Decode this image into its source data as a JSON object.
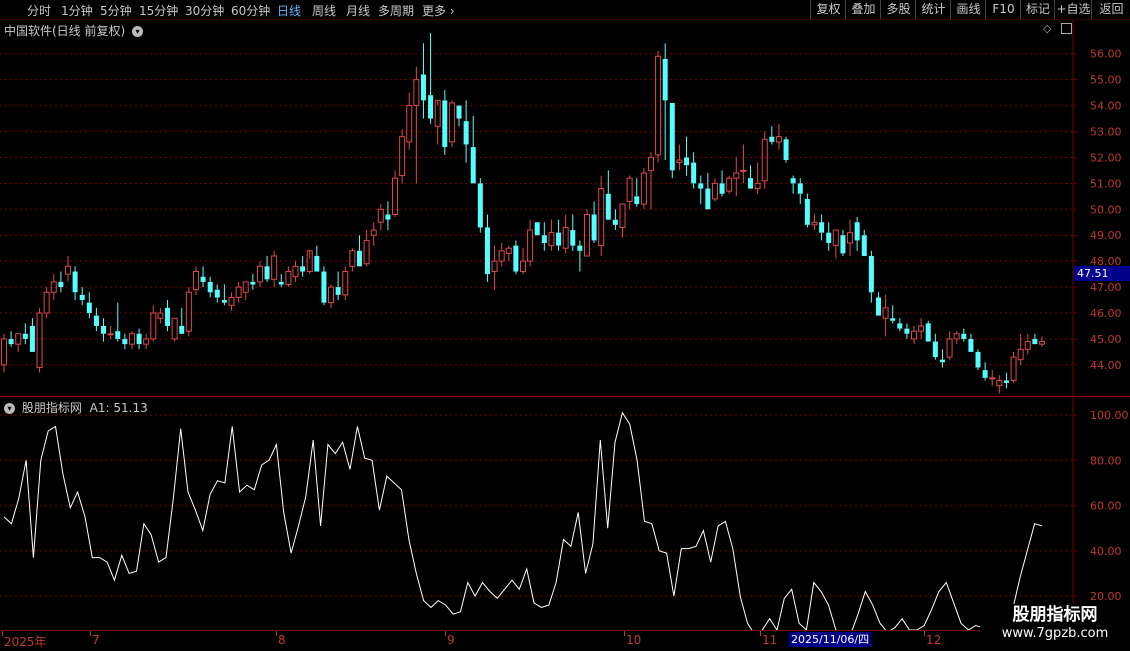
{
  "toolbar": {
    "left": [
      "分时",
      "1分钟",
      "5分钟",
      "15分钟",
      "30分钟",
      "60分钟",
      "日线",
      "周线",
      "月线",
      "多周期",
      "更多"
    ],
    "active": "日线",
    "right": [
      "复权",
      "叠加",
      "多股",
      "统计",
      "画线",
      "F10",
      "标记",
      "+自选",
      "返回"
    ]
  },
  "main_panel": {
    "title": "中国软件(日线 前复权)",
    "current_price": "47.51"
  },
  "indicator_panel": {
    "name": "股朋指标网",
    "value_label": "A1: 51.13"
  },
  "x_axis": {
    "labels": [
      "2025年",
      "7",
      "8",
      "9",
      "10",
      "11",
      "12"
    ],
    "crosshair_date": "2025/11/06/四"
  },
  "watermark": {
    "title": "股朋指标网",
    "url": "www.7gpzb.com"
  },
  "colors": {
    "up": "#e04848",
    "down": "#54ffff",
    "grid": "#7a0000",
    "line": "#ffffff"
  },
  "chart_data": [
    {
      "type": "candlestick",
      "title": "中国软件(日线 前复权)",
      "y_ticks": [
        44,
        45,
        46,
        47,
        48,
        49,
        50,
        51,
        52,
        53,
        54,
        55,
        56
      ],
      "ylim": [
        42.8,
        57.3
      ],
      "candles": [
        [
          44,
          45.2,
          43.7,
          45
        ],
        [
          45,
          45.3,
          44.7,
          44.8
        ],
        [
          44.8,
          45.2,
          44.5,
          45.2
        ],
        [
          45.2,
          45.6,
          44.8,
          45
        ],
        [
          45.5,
          45.8,
          44.5,
          44.5
        ],
        [
          43.9,
          46.2,
          43.7,
          46
        ],
        [
          46,
          47,
          45.8,
          46.8
        ],
        [
          46.8,
          47.5,
          46.5,
          47.2
        ],
        [
          47.2,
          47.6,
          46.8,
          47
        ],
        [
          47.5,
          48.2,
          47.2,
          47.8
        ],
        [
          47.6,
          47.8,
          46.5,
          46.8
        ],
        [
          46.7,
          47,
          46.3,
          46.5
        ],
        [
          46.4,
          46.8,
          45.8,
          46
        ],
        [
          45.9,
          46.2,
          45.3,
          45.5
        ],
        [
          45.5,
          45.8,
          44.9,
          45.2
        ],
        [
          45.2,
          45.5,
          45,
          45.2
        ],
        [
          45.3,
          46.4,
          44.9,
          45
        ],
        [
          45,
          45.2,
          44.6,
          44.8
        ],
        [
          44.8,
          45.3,
          44.6,
          45.2
        ],
        [
          45.2,
          45.4,
          44.6,
          44.8
        ],
        [
          44.8,
          45.2,
          44.6,
          45
        ],
        [
          45,
          46.3,
          44.9,
          46
        ],
        [
          45.8,
          46.2,
          45.6,
          46
        ],
        [
          46.2,
          46.5,
          45.3,
          45.5
        ],
        [
          45,
          45.8,
          44.9,
          45.8
        ],
        [
          45.5,
          46.2,
          45.3,
          45.2
        ],
        [
          45.3,
          47,
          45.1,
          46.8
        ],
        [
          46.9,
          47.8,
          46.7,
          47.6
        ],
        [
          47.4,
          47.8,
          47,
          47.2
        ],
        [
          47.2,
          47.4,
          46.6,
          46.8
        ],
        [
          46.9,
          47.1,
          46.4,
          46.6
        ],
        [
          46.5,
          47.1,
          46.3,
          46.4
        ],
        [
          46.3,
          46.8,
          46.1,
          46.6
        ],
        [
          46.6,
          47.2,
          46.4,
          47
        ],
        [
          46.8,
          47.2,
          46.5,
          47.2
        ],
        [
          47.2,
          47.5,
          46.9,
          47.1
        ],
        [
          47.2,
          48,
          47,
          47.8
        ],
        [
          47.8,
          48.2,
          47.2,
          47.3
        ],
        [
          47.3,
          48.4,
          47,
          48.2
        ],
        [
          47.2,
          47.5,
          47,
          47.1
        ],
        [
          47.1,
          47.8,
          47,
          47.6
        ],
        [
          47.4,
          48,
          47.2,
          47.8
        ],
        [
          47.8,
          48.2,
          47.4,
          47.6
        ],
        [
          47.6,
          48.1,
          47.5,
          48.4
        ],
        [
          48.2,
          48.6,
          47.6,
          47.6
        ],
        [
          47.6,
          47.8,
          46.3,
          46.4
        ],
        [
          46.4,
          47.1,
          46.2,
          47
        ],
        [
          47,
          47.6,
          46.5,
          46.7
        ],
        [
          46.7,
          47.8,
          46.5,
          47.6
        ],
        [
          47.8,
          48.5,
          47.6,
          48.4
        ],
        [
          48.4,
          49,
          47.8,
          47.8
        ],
        [
          47.9,
          49.2,
          47.8,
          48.8
        ],
        [
          49,
          49.5,
          48.6,
          49.2
        ],
        [
          49.5,
          50.2,
          49.2,
          50
        ],
        [
          49.8,
          50.3,
          49.2,
          49.6
        ],
        [
          49.8,
          51.5,
          49.7,
          51.2
        ],
        [
          51.3,
          53.1,
          51,
          52.8
        ],
        [
          52.6,
          54.5,
          52.3,
          54
        ],
        [
          54,
          55.5,
          51,
          55
        ],
        [
          55.2,
          56.4,
          53.5,
          54.2
        ],
        [
          54.4,
          56.8,
          53.3,
          53.5
        ],
        [
          53.2,
          54,
          52.5,
          54.2
        ],
        [
          54.2,
          54.6,
          52.1,
          52.4
        ],
        [
          52.6,
          54.2,
          52.4,
          54.1
        ],
        [
          54,
          54,
          53.2,
          53.5
        ],
        [
          53.4,
          54.2,
          51.8,
          52.5
        ],
        [
          52.4,
          53.6,
          51,
          51
        ],
        [
          51,
          51.2,
          49.1,
          49.3
        ],
        [
          49.3,
          49.8,
          47.2,
          47.5
        ],
        [
          47.6,
          48.6,
          46.9,
          48
        ],
        [
          48,
          48.7,
          47.8,
          48.4
        ],
        [
          48.3,
          48.6,
          48,
          48.5
        ],
        [
          48.6,
          48.8,
          47.5,
          47.6
        ],
        [
          47.6,
          48.5,
          47.5,
          48
        ],
        [
          48,
          49.6,
          47.8,
          49.2
        ],
        [
          49.5,
          49.5,
          49,
          49
        ],
        [
          49,
          49.5,
          48.4,
          48.7
        ],
        [
          48.6,
          49.6,
          48.4,
          49.1
        ],
        [
          49.1,
          49.6,
          48.4,
          48.6
        ],
        [
          48.5,
          49.8,
          48.3,
          49.3
        ],
        [
          49.2,
          49.8,
          48.4,
          48.6
        ],
        [
          48.6,
          48.8,
          47.6,
          48.4
        ],
        [
          48.2,
          50,
          48.2,
          49.8
        ],
        [
          49.8,
          50.3,
          48.7,
          48.8
        ],
        [
          48.6,
          51.3,
          48.2,
          50.8
        ],
        [
          50.6,
          51.5,
          49.6,
          49.6
        ],
        [
          49.6,
          50,
          49.2,
          49.4
        ],
        [
          49.3,
          50.2,
          48.9,
          50.2
        ],
        [
          50.3,
          51.3,
          50,
          51.2
        ],
        [
          50.5,
          51.2,
          50.1,
          50.2
        ],
        [
          50.2,
          51.6,
          50,
          51.4
        ],
        [
          51.5,
          52.2,
          50,
          52
        ],
        [
          52.1,
          56.1,
          51.8,
          55.9
        ],
        [
          55.8,
          56.4,
          51.9,
          54.2
        ],
        [
          54.1,
          54.1,
          51.2,
          51.5
        ],
        [
          51.8,
          52.5,
          51.5,
          51.9
        ],
        [
          52,
          52.8,
          51.3,
          51.7
        ],
        [
          51.8,
          52.2,
          50.8,
          51
        ],
        [
          51,
          51.3,
          50.2,
          50.8
        ],
        [
          50.8,
          51.4,
          50.2,
          50
        ],
        [
          50.4,
          51.2,
          50.3,
          51
        ],
        [
          51,
          51.5,
          50.5,
          50.6
        ],
        [
          50.7,
          51.3,
          50.6,
          51.2
        ],
        [
          51.2,
          52,
          50.5,
          51.4
        ],
        [
          51.5,
          52.5,
          51,
          51.5
        ],
        [
          51.2,
          51.7,
          51,
          50.8
        ],
        [
          50.8,
          51.8,
          50.6,
          51
        ],
        [
          51.1,
          53,
          50.8,
          52.7
        ],
        [
          52.8,
          53.2,
          52.5,
          52.6
        ],
        [
          52.6,
          53.3,
          52.3,
          52.8
        ],
        [
          52.7,
          52.8,
          51.8,
          51.9
        ],
        [
          51.2,
          51.3,
          50.6,
          51
        ],
        [
          51,
          51.2,
          50.2,
          50.6
        ],
        [
          50.4,
          50.6,
          49.3,
          49.4
        ],
        [
          49.4,
          49.8,
          49.2,
          49.5
        ],
        [
          49.5,
          49.8,
          48.8,
          49.1
        ],
        [
          49.1,
          49.5,
          48.4,
          48.7
        ],
        [
          48.6,
          49.2,
          48.1,
          49.2
        ],
        [
          49,
          49.2,
          48.2,
          48.3
        ],
        [
          48.7,
          49.6,
          48.2,
          49.1
        ],
        [
          49.5,
          49.7,
          48.4,
          48.8
        ],
        [
          49,
          49.2,
          48.2,
          48.2
        ],
        [
          48.2,
          48.4,
          46.4,
          46.8
        ],
        [
          46.6,
          46.8,
          45.9,
          45.9
        ],
        [
          45.8,
          46.7,
          45.1,
          46.2
        ],
        [
          45.8,
          46.3,
          45.6,
          45.7
        ],
        [
          45.6,
          45.8,
          45.3,
          45.4
        ],
        [
          45.4,
          45.6,
          45,
          45.2
        ],
        [
          45,
          45.5,
          44.8,
          45.3
        ],
        [
          45.3,
          45.8,
          45,
          45.5
        ],
        [
          45.6,
          45.7,
          44.9,
          44.9
        ],
        [
          44.9,
          45.2,
          44.2,
          44.3
        ],
        [
          44.2,
          44.6,
          43.9,
          44.1
        ],
        [
          44.3,
          45.3,
          44.2,
          45
        ],
        [
          45,
          45.3,
          44.8,
          45.2
        ],
        [
          45.2,
          45.4,
          44.9,
          45
        ],
        [
          45,
          45.2,
          44.5,
          44.5
        ],
        [
          44.5,
          44.6,
          43.8,
          43.9
        ],
        [
          43.8,
          44.1,
          43.4,
          43.5
        ],
        [
          43.5,
          43.8,
          43.2,
          43.5
        ],
        [
          43.2,
          43.6,
          42.9,
          43.4
        ],
        [
          43.4,
          43.7,
          43.1,
          43.3
        ],
        [
          43.4,
          44.5,
          43.3,
          44.3
        ],
        [
          44.2,
          45.2,
          44,
          44.6
        ],
        [
          44.6,
          45.2,
          44.4,
          44.9
        ],
        [
          45,
          45.2,
          44.8,
          44.8
        ],
        [
          44.8,
          45.1,
          44.7,
          44.9
        ]
      ],
      "last_price": 47.51
    },
    {
      "type": "line",
      "title": "股朋指标网",
      "y_ticks": [
        20,
        40,
        60,
        80,
        100
      ],
      "ylim": [
        5,
        108
      ],
      "series": [
        {
          "name": "A1",
          "values": [
            55,
            52,
            63,
            80,
            37,
            80,
            93,
            95,
            74,
            59,
            66,
            55,
            37,
            37,
            35,
            27,
            38,
            30,
            31,
            52,
            47,
            35,
            37,
            63,
            94,
            66,
            58,
            49,
            65,
            71,
            70,
            95,
            66,
            69,
            67,
            78,
            80,
            87,
            57,
            39,
            51,
            64,
            89,
            51,
            87,
            83,
            88,
            76,
            95,
            81,
            80,
            58,
            73,
            70,
            67,
            45,
            30,
            18,
            15,
            18,
            16,
            12,
            13,
            26,
            20,
            26,
            22,
            19,
            23,
            27,
            23,
            32,
            17,
            15,
            16,
            26,
            45,
            42,
            57,
            30,
            43,
            89,
            50,
            88,
            101,
            96,
            80,
            53,
            52,
            40,
            39,
            20,
            41,
            41,
            42,
            49,
            35,
            51,
            53,
            41,
            20,
            8,
            3,
            5,
            10,
            5,
            19,
            23,
            8,
            5,
            26,
            22,
            16,
            5,
            3,
            3,
            12,
            22,
            16,
            8,
            4,
            6,
            10,
            5,
            5,
            7,
            14,
            22,
            26,
            17,
            8,
            5,
            7,
            6,
            5,
            2,
            3,
            14,
            28,
            40,
            52,
            51
          ]
        }
      ]
    }
  ]
}
